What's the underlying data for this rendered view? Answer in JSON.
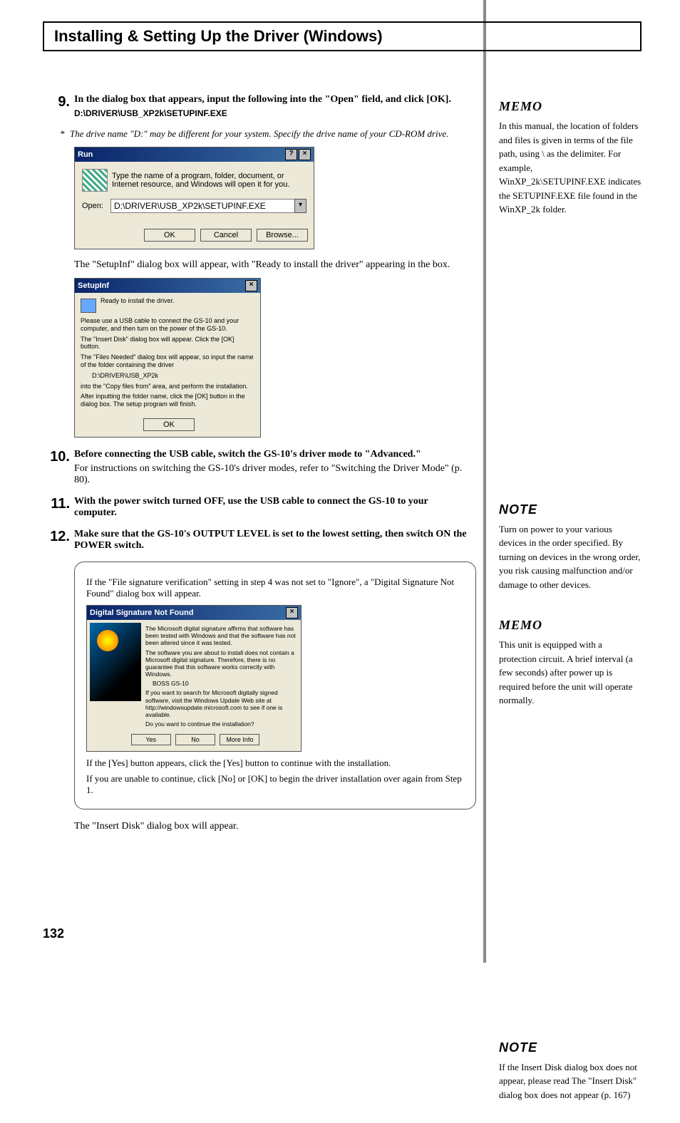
{
  "title": "Installing & Setting Up the Driver (Windows)",
  "page_number": "132",
  "steps": {
    "s9": {
      "num": "9.",
      "line1": "In the dialog box that appears, input the following into the \"Open\" field, and click [OK].",
      "path": "D:\\DRIVER\\USB_XP2k\\SETUPINF.EXE",
      "footnote_star": "*",
      "footnote": "The drive name \"D:\" may be different for your system. Specify the drive name of your CD-ROM drive."
    },
    "s10": {
      "num": "10.",
      "line1": "Before connecting the USB cable, switch the GS-10's driver mode to \"Advanced.\"",
      "line2": "For instructions on switching the GS-10's driver modes, refer to \"Switching the Driver Mode\" (p. 80)."
    },
    "s11": {
      "num": "11.",
      "line1": "With the power switch turned OFF, use the USB cable to connect the GS-10 to your computer."
    },
    "s12": {
      "num": "12.",
      "line1": "Make sure that the GS-10's OUTPUT LEVEL is set to the lowest setting, then switch ON the POWER switch."
    }
  },
  "run_dlg": {
    "title": "Run",
    "help_btn": "?",
    "close_btn": "×",
    "prompt": "Type the name of a program, folder, document, or Internet resource, and Windows will open it for you.",
    "open_label": "Open:",
    "input_value": "D:\\DRIVER\\USB_XP2k\\SETUPINF.EXE",
    "dd": "▾",
    "ok": "OK",
    "cancel": "Cancel",
    "browse": "Browse..."
  },
  "after_run": "The \"SetupInf\" dialog box will appear, with \"Ready to install the driver\" appearing in the box.",
  "setupinf": {
    "title": "SetupInf",
    "close_btn": "×",
    "ready": "Ready to install the driver.",
    "l1": "Please use a USB cable to connect the GS-10 and your computer, and then turn on the power of the GS-10.",
    "l2": "The \"Insert Disk\" dialog box will appear. Click the [OK] button.",
    "l3": "The \"Files Needed\" dialog box will appear, so input the name of the folder containing the driver",
    "path": "D:\\DRIVER\\USB_XP2k",
    "l4": "into the \"Copy files from\" area, and perform the installation.",
    "l5": "After inputting the folder name, click the [OK] button in the dialog box. The setup program will finish.",
    "ok": "OK"
  },
  "callout": {
    "p1": "If the \"File signature verification\" setting in step 4 was not set to \"Ignore\", a \"Digital Signature Not Found\" dialog box will appear.",
    "p2": "If the [Yes] button appears, click the [Yes] button to continue with the installation.",
    "p3": "If you are unable to continue, click [No] or [OK] to begin the driver installation over again from Step 1."
  },
  "dsig": {
    "title": "Digital Signature Not Found",
    "close_btn": "×",
    "p1": "The Microsoft digital signature affirms that software has been tested with Windows and that the software has not been altered since it was tested.",
    "p2": "The software you are about to install does not contain a Microsoft digital signature. Therefore, there is no guarantee that this software works correctly with Windows.",
    "prod": "BOSS GS-10",
    "p3": "If you want to search for Microsoft digitally signed software, visit the Windows Update Web site at http://windowsupdate.microsoft.com to see if one is available.",
    "q": "Do you want to continue the installation?",
    "yes": "Yes",
    "no": "No",
    "more": "More Info"
  },
  "after_callout": "The \"Insert Disk\" dialog box will appear.",
  "sidebar": {
    "memo1_label": "MEMO",
    "memo1": "In this manual, the location of folders and files is given in terms of the file path, using \\ as the delimiter. For example, WinXP_2k\\SETUPINF.EXE indicates the SETUPINF.EXE file found in the WinXP_2k folder.",
    "note1_label": "NOTE",
    "note1": "Turn on power to your various devices in the order specified. By turning on devices in the wrong order, you risk causing malfunction and/or damage to other devices.",
    "memo2_label": "MEMO",
    "memo2": "This unit is equipped with a protection circuit. A brief interval (a few seconds) after power up is required before the unit will operate normally.",
    "note2_label": "NOTE",
    "note2": "If the Insert Disk dialog box does not appear, please read The \"Insert Disk\" dialog box does not appear (p. 167)"
  }
}
